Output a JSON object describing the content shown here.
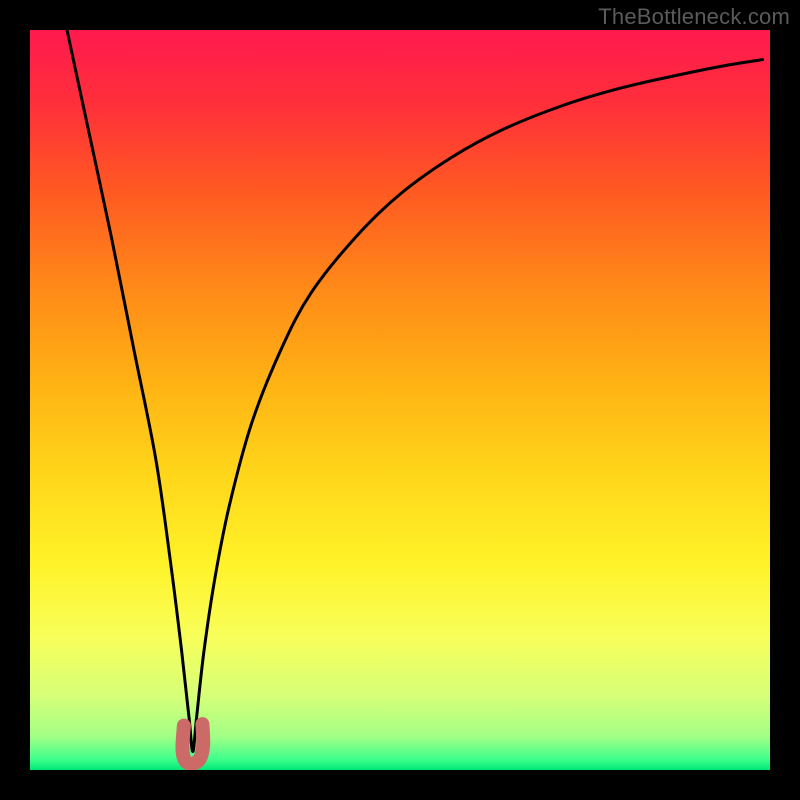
{
  "watermark": {
    "text": "TheBottleneck.com"
  },
  "gradient": {
    "stops": [
      {
        "offset": 0.0,
        "color": "#ff1a4e"
      },
      {
        "offset": 0.1,
        "color": "#ff2f3a"
      },
      {
        "offset": 0.22,
        "color": "#ff5a22"
      },
      {
        "offset": 0.35,
        "color": "#ff8a18"
      },
      {
        "offset": 0.48,
        "color": "#ffb314"
      },
      {
        "offset": 0.6,
        "color": "#ffd61a"
      },
      {
        "offset": 0.72,
        "color": "#fff228"
      },
      {
        "offset": 0.82,
        "color": "#f8ff5a"
      },
      {
        "offset": 0.9,
        "color": "#d6ff78"
      },
      {
        "offset": 0.955,
        "color": "#a2ff86"
      },
      {
        "offset": 0.985,
        "color": "#40ff8c"
      },
      {
        "offset": 1.0,
        "color": "#00e876"
      }
    ]
  },
  "chart_data": {
    "type": "line",
    "title": "",
    "xlabel": "",
    "ylabel": "",
    "xlim": [
      0,
      100
    ],
    "ylim": [
      0,
      100
    ],
    "min_x": 22,
    "series": [
      {
        "name": "bottleneck-curve",
        "x": [
          5,
          8,
          11,
          14,
          17,
          19,
          20.5,
          21.5,
          22,
          22.5,
          23.5,
          25,
          27,
          30,
          34,
          38,
          44,
          50,
          57,
          64,
          72,
          80,
          88,
          94,
          99
        ],
        "y": [
          100,
          86,
          72,
          57,
          42,
          28,
          16,
          7,
          2.5,
          7,
          16,
          26,
          36,
          47,
          57,
          64.5,
          72,
          77.8,
          82.8,
          86.6,
          89.8,
          92.2,
          94.0,
          95.2,
          96.0
        ]
      }
    ],
    "marker": {
      "name": "optimal-region",
      "color": "#cb6a67",
      "points_x": [
        20.8,
        20.6,
        20.8,
        21.4,
        22.2,
        23.0,
        23.4,
        23.3
      ],
      "points_y": [
        6.0,
        3.2,
        1.6,
        0.9,
        0.9,
        1.6,
        3.4,
        6.2
      ]
    }
  }
}
